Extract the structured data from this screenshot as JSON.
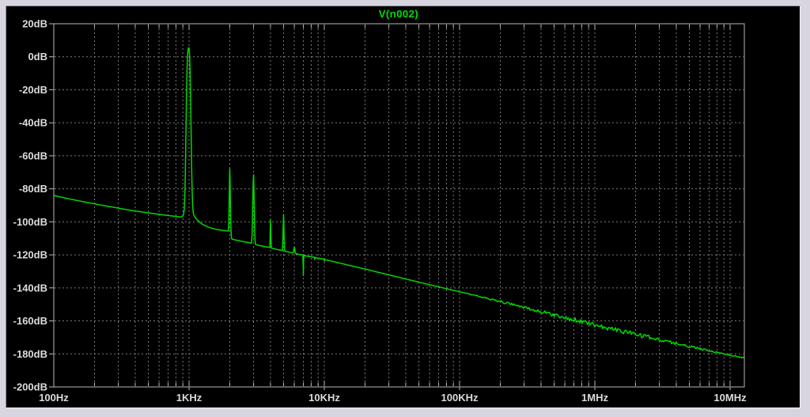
{
  "title": "V(n002)",
  "colors": {
    "frame": "#d8d5e1",
    "background": "#000000",
    "trace": "#00d800",
    "title_green": "#00e000",
    "grid": "#7a7a7a",
    "axis_border": "#b8b8b8",
    "tick_label": "#dcdcdc"
  },
  "chart_data": {
    "type": "line",
    "title": "V(n002)",
    "x_scale": "log",
    "y_scale": "linear",
    "xlim": [
      100,
      12700000
    ],
    "ylim": [
      -200,
      20
    ],
    "grid": true,
    "legend_position": "top-center",
    "legend": [
      "V(n002)"
    ],
    "x_ticks": [
      {
        "label": "100Hz",
        "value": 100
      },
      {
        "label": "1KHz",
        "value": 1000
      },
      {
        "label": "10KHz",
        "value": 10000
      },
      {
        "label": "100KHz",
        "value": 100000
      },
      {
        "label": "1MHz",
        "value": 1000000
      },
      {
        "label": "10MHz",
        "value": 10000000
      }
    ],
    "y_ticks": [
      {
        "label": "20dB",
        "value": 20
      },
      {
        "label": "0dB",
        "value": 0
      },
      {
        "label": "-20dB",
        "value": -20
      },
      {
        "label": "-40dB",
        "value": -40
      },
      {
        "label": "-60dB",
        "value": -60
      },
      {
        "label": "-80dB",
        "value": -80
      },
      {
        "label": "-100dB",
        "value": -100
      },
      {
        "label": "-120dB",
        "value": -120
      },
      {
        "label": "-140dB",
        "value": -140
      },
      {
        "label": "-160dB",
        "value": -160
      },
      {
        "label": "-180dB",
        "value": -180
      },
      {
        "label": "-200dB",
        "value": -200
      }
    ],
    "series": [
      {
        "name": "V(n002)",
        "color": "#00d800",
        "points": [
          [
            100,
            -84.0
          ],
          [
            110,
            -84.8
          ],
          [
            122,
            -85.6
          ],
          [
            136,
            -86.4
          ],
          [
            152,
            -87.2
          ],
          [
            170,
            -88.0
          ],
          [
            190,
            -88.7
          ],
          [
            212,
            -89.5
          ],
          [
            240,
            -90.3
          ],
          [
            270,
            -91.0
          ],
          [
            305,
            -91.8
          ],
          [
            345,
            -92.6
          ],
          [
            390,
            -93.3
          ],
          [
            440,
            -93.9
          ],
          [
            495,
            -94.5
          ],
          [
            555,
            -95.1
          ],
          [
            620,
            -95.6
          ],
          [
            695,
            -96.1
          ],
          [
            775,
            -96.6
          ],
          [
            850,
            -97.0
          ],
          [
            880,
            -96.9
          ],
          [
            900,
            -96.4
          ],
          [
            912,
            -95.2
          ],
          [
            922,
            -92.0
          ],
          [
            930,
            -85.0
          ],
          [
            937,
            -73.0
          ],
          [
            944,
            -57.0
          ],
          [
            951,
            -39.0
          ],
          [
            958,
            -22.0
          ],
          [
            965,
            -9.0
          ],
          [
            972,
            -1.0
          ],
          [
            980,
            3.5
          ],
          [
            988,
            5.2
          ],
          [
            996,
            5.5
          ],
          [
            1003,
            4.2
          ],
          [
            1009,
            0.5
          ],
          [
            1015,
            -6.0
          ],
          [
            1022,
            -17.0
          ],
          [
            1030,
            -33.0
          ],
          [
            1038,
            -51.0
          ],
          [
            1046,
            -68.0
          ],
          [
            1054,
            -81.0
          ],
          [
            1062,
            -89.5
          ],
          [
            1072,
            -94.0
          ],
          [
            1084,
            -95.8
          ],
          [
            1098,
            -96.7
          ],
          [
            1118,
            -97.7
          ],
          [
            1145,
            -98.7
          ],
          [
            1175,
            -99.6
          ],
          [
            1215,
            -100.6
          ],
          [
            1265,
            -101.6
          ],
          [
            1325,
            -102.5
          ],
          [
            1400,
            -103.3
          ],
          [
            1490,
            -104.0
          ],
          [
            1600,
            -104.6
          ],
          [
            1720,
            -105.0
          ],
          [
            1850,
            -105.4
          ],
          [
            1950,
            -105.6
          ],
          [
            1966,
            -101.0
          ],
          [
            1978,
            -89.0
          ],
          [
            1990,
            -75.0
          ],
          [
            2000,
            -68.0
          ],
          [
            2011,
            -77.0
          ],
          [
            2024,
            -91.0
          ],
          [
            2038,
            -103.0
          ],
          [
            2055,
            -109.5
          ],
          [
            2075,
            -110.4
          ],
          [
            2160,
            -110.8
          ],
          [
            2320,
            -111.4
          ],
          [
            2500,
            -111.9
          ],
          [
            2700,
            -112.4
          ],
          [
            2895,
            -112.9
          ],
          [
            2923,
            -108.0
          ],
          [
            2944,
            -96.0
          ],
          [
            2964,
            -84.0
          ],
          [
            2984,
            -74.5
          ],
          [
            3000,
            -71.5
          ],
          [
            3016,
            -79.0
          ],
          [
            3036,
            -92.0
          ],
          [
            3056,
            -104.0
          ],
          [
            3076,
            -111.0
          ],
          [
            3098,
            -113.7
          ],
          [
            3210,
            -114.1
          ],
          [
            3420,
            -114.6
          ],
          [
            3640,
            -115.0
          ],
          [
            3870,
            -115.4
          ],
          [
            3955,
            -115.6
          ],
          [
            3970,
            -110.0
          ],
          [
            3986,
            -103.5
          ],
          [
            4000,
            -98.8
          ],
          [
            4016,
            -104.5
          ],
          [
            4036,
            -111.0
          ],
          [
            4062,
            -115.9
          ],
          [
            4210,
            -116.2
          ],
          [
            4460,
            -116.7
          ],
          [
            4720,
            -117.1
          ],
          [
            4905,
            -117.3
          ],
          [
            4928,
            -113.0
          ],
          [
            4952,
            -106.0
          ],
          [
            4976,
            -99.8
          ],
          [
            5000,
            -95.5
          ],
          [
            5022,
            -101.5
          ],
          [
            5046,
            -109.0
          ],
          [
            5072,
            -115.0
          ],
          [
            5102,
            -117.7
          ],
          [
            5260,
            -118.0
          ],
          [
            5460,
            -118.3
          ],
          [
            5660,
            -118.6
          ],
          [
            5865,
            -118.9
          ],
          [
            5925,
            -117.9
          ],
          [
            5962,
            -116.3
          ],
          [
            6000,
            -115.3
          ],
          [
            6040,
            -116.5
          ],
          [
            6085,
            -118.6
          ],
          [
            6130,
            -119.2
          ],
          [
            6310,
            -119.4
          ],
          [
            6560,
            -119.7
          ],
          [
            6810,
            -119.9
          ],
          [
            6925,
            -120.1
          ],
          [
            6952,
            -122.0
          ],
          [
            6976,
            -127.5
          ],
          [
            6996,
            -132.5
          ],
          [
            7012,
            -128.5
          ],
          [
            7028,
            -123.5
          ],
          [
            7064,
            -121.0
          ],
          [
            7125,
            -120.5
          ],
          [
            7420,
            -120.7
          ],
          [
            7820,
            -121.0
          ],
          [
            8230,
            -121.3
          ],
          [
            8450,
            -121.5
          ],
          [
            8500,
            -122.8
          ],
          [
            8555,
            -121.7
          ],
          [
            8900,
            -121.9
          ],
          [
            9400,
            -122.3
          ],
          [
            9950,
            -122.6
          ],
          [
            10000,
            -123.8
          ],
          [
            10060,
            -122.8
          ],
          [
            12000,
            -124.3
          ],
          [
            15000,
            -126.2
          ],
          [
            20000,
            -128.6
          ],
          [
            26000,
            -130.9
          ],
          [
            34000,
            -133.2
          ],
          [
            45000,
            -135.6
          ],
          [
            60000,
            -138.1
          ],
          [
            80000,
            -140.5
          ],
          [
            100000,
            -142.4
          ],
          [
            130000,
            -144.5
          ],
          [
            170000,
            -146.8
          ],
          [
            220000,
            -149.1
          ],
          [
            290000,
            -151.5
          ],
          [
            380000,
            -153.9
          ],
          [
            500000,
            -156.3
          ],
          [
            650000,
            -158.6
          ],
          [
            850000,
            -161.0
          ],
          [
            1100000,
            -163.3
          ],
          [
            1450000,
            -165.5
          ],
          [
            1900000,
            -167.7
          ],
          [
            2500000,
            -169.9
          ],
          [
            3300000,
            -172.2
          ],
          [
            4300000,
            -174.3
          ],
          [
            5600000,
            -176.4
          ],
          [
            7300000,
            -178.4
          ],
          [
            9500000,
            -180.3
          ],
          [
            11000000,
            -181.4
          ],
          [
            12000000,
            -182.0
          ],
          [
            12700000,
            -182.3
          ]
        ]
      }
    ],
    "noise_band": [
      [
        95000,
        0.0
      ],
      [
        150000,
        0.45
      ],
      [
        250000,
        0.75
      ],
      [
        400000,
        1.0
      ],
      [
        650000,
        1.25
      ],
      [
        1000000,
        1.4
      ],
      [
        1800000,
        1.45
      ],
      [
        2600000,
        1.25
      ],
      [
        3600000,
        0.95
      ],
      [
        5000000,
        0.7
      ],
      [
        7000000,
        0.5
      ],
      [
        9000000,
        0.35
      ],
      [
        12700000,
        0.3
      ]
    ]
  }
}
